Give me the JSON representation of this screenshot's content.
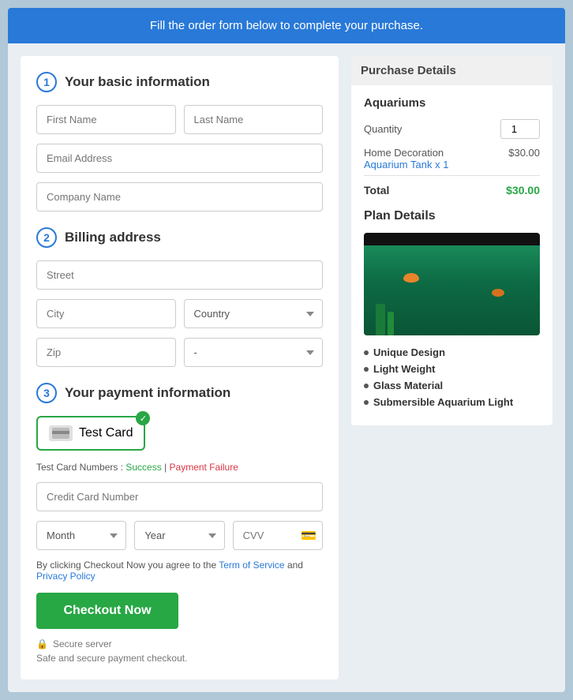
{
  "banner": {
    "text": "Fill the order form below to complete your purchase."
  },
  "form": {
    "section1": {
      "number": "1",
      "title": "Your basic information"
    },
    "section2": {
      "number": "2",
      "title": "Billing address"
    },
    "section3": {
      "number": "3",
      "title": "Your payment information"
    },
    "fields": {
      "first_name_placeholder": "First Name",
      "last_name_placeholder": "Last Name",
      "email_placeholder": "Email Address",
      "company_placeholder": "Company Name",
      "street_placeholder": "Street",
      "city_placeholder": "City",
      "country_placeholder": "Country",
      "zip_placeholder": "Zip",
      "state_placeholder": "-",
      "credit_card_placeholder": "Credit Card Number",
      "month_placeholder": "Month",
      "year_placeholder": "Year",
      "cvv_placeholder": "CVV"
    },
    "payment": {
      "card_label": "Test Card",
      "test_card_prefix": "Test Card Numbers : ",
      "success_link": "Success",
      "separator": " | ",
      "failure_link": "Payment Failure"
    },
    "agree": {
      "prefix": "By clicking Checkout Now you agree to the ",
      "tos_link": "Term of Service",
      "middle": " and ",
      "privacy_link": "Privacy Policy"
    },
    "checkout_button": "Checkout Now",
    "secure_label": "Secure server",
    "safe_text": "Safe and secure payment checkout."
  },
  "purchase": {
    "title": "Purchase Details",
    "product_name": "Aquariums",
    "quantity_label": "Quantity",
    "quantity_value": "1",
    "item_name": "Home Decoration",
    "item_sub": "Aquarium Tank x 1",
    "item_price": "$30.00",
    "total_label": "Total",
    "total_amount": "$30.00",
    "plan_title": "Plan Details",
    "features": [
      "Unique Design",
      "Light Weight",
      "Glass Material",
      "Submersible Aquarium Light"
    ]
  }
}
